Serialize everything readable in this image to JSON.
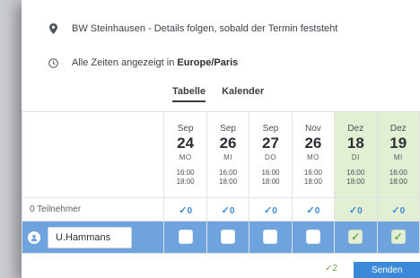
{
  "location": {
    "icon": "map-pin-icon",
    "text": "BW Steinhausen - Details folgen, sobald der Termin feststeht"
  },
  "timezone": {
    "icon": "clock-icon",
    "prefix": "Alle Zeiten angezeigt in ",
    "zone": "Europe/Paris"
  },
  "tabs": [
    {
      "label": "Tabelle",
      "active": true
    },
    {
      "label": "Kalender",
      "active": false
    }
  ],
  "dates": [
    {
      "month": "Sep",
      "day": "24",
      "weekday": "MO",
      "start": "16:00",
      "end": "18:00",
      "count": "0",
      "checked": false,
      "selected": false
    },
    {
      "month": "Sep",
      "day": "26",
      "weekday": "MI",
      "start": "16:00",
      "end": "18:00",
      "count": "0",
      "checked": false,
      "selected": false
    },
    {
      "month": "Sep",
      "day": "27",
      "weekday": "DO",
      "start": "16:00",
      "end": "18:00",
      "count": "0",
      "checked": false,
      "selected": false
    },
    {
      "month": "Nov",
      "day": "26",
      "weekday": "MO",
      "start": "16:00",
      "end": "18:00",
      "count": "0",
      "checked": false,
      "selected": false
    },
    {
      "month": "Dez",
      "day": "18",
      "weekday": "DI",
      "start": "16:00",
      "end": "18:00",
      "count": "0",
      "checked": true,
      "selected": true
    },
    {
      "month": "Dez",
      "day": "19",
      "weekday": "MI",
      "start": "16:00",
      "end": "18:00",
      "count": "0",
      "checked": true,
      "selected": true
    }
  ],
  "participants_label": "0 Teilnehmer",
  "participant": {
    "icon": "user-icon",
    "name": "U.Hammans"
  },
  "footer": {
    "selected_count": "2",
    "send_label": "Senden"
  },
  "colors": {
    "accent": "#3b8ad9",
    "selected_bg": "#e3efd2",
    "row_highlight": "#6ea3de",
    "check_green": "#6aa84f"
  }
}
